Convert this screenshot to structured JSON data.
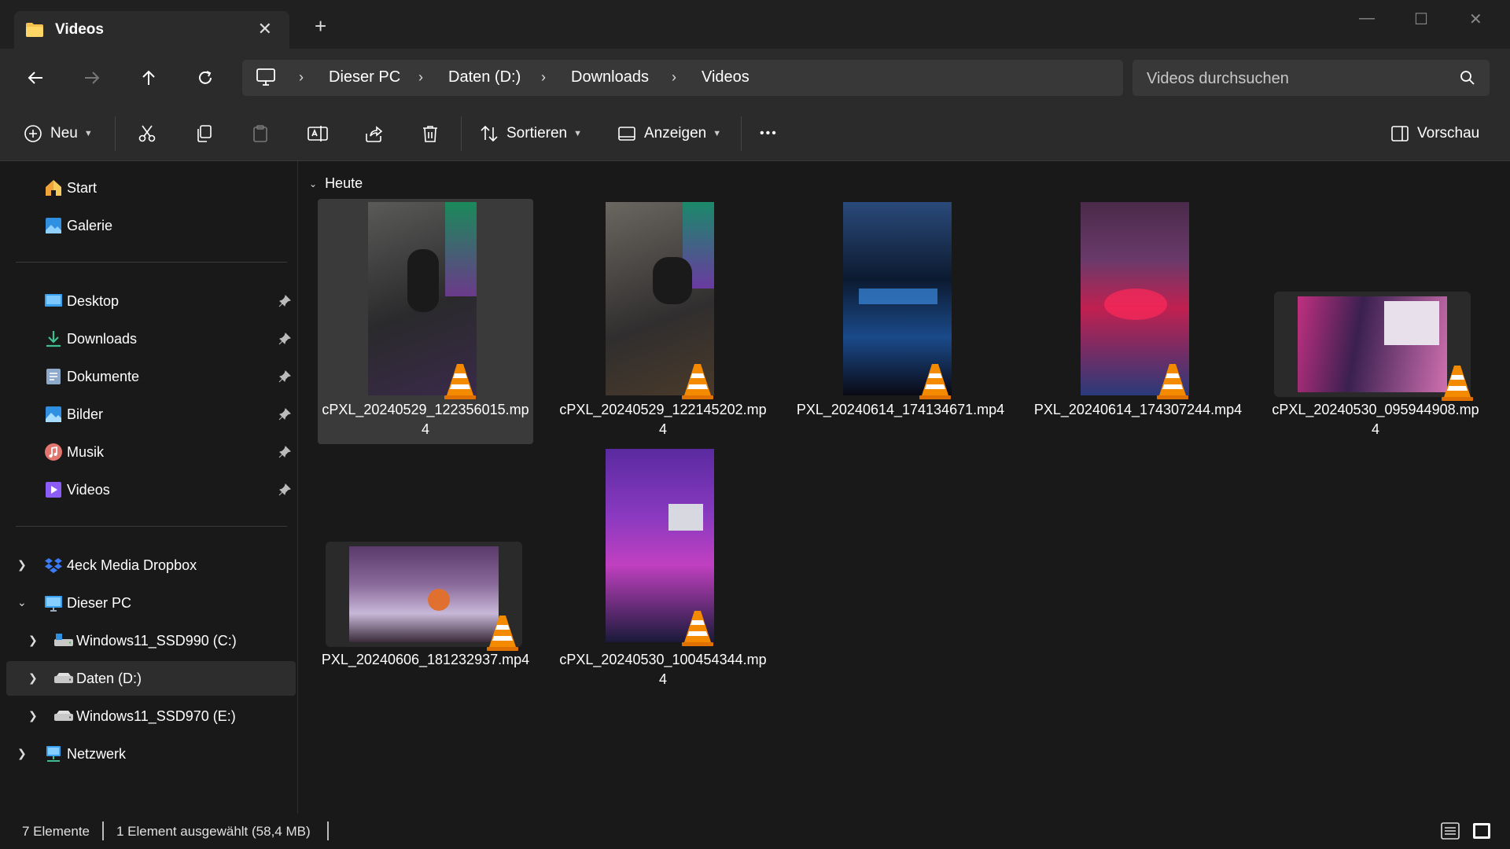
{
  "tab": {
    "title": "Videos",
    "close": "✕",
    "new": "+"
  },
  "window": {
    "minimize": "—",
    "maximize": "☐",
    "close": "✕"
  },
  "address": {
    "crumbs": [
      "Dieser PC",
      "Daten (D:)",
      "Downloads",
      "Videos"
    ],
    "separator": "›"
  },
  "search": {
    "placeholder": "Videos durchsuchen"
  },
  "toolbar": {
    "new_label": "Neu",
    "sort_label": "Sortieren",
    "view_label": "Anzeigen",
    "more_label": "•••",
    "preview_label": "Vorschau"
  },
  "sidebar": {
    "top": [
      {
        "label": "Start",
        "icon": "home-icon"
      },
      {
        "label": "Galerie",
        "icon": "gallery-icon"
      }
    ],
    "quick": [
      {
        "label": "Desktop",
        "icon": "desktop-icon",
        "color": "#3aa0f0"
      },
      {
        "label": "Downloads",
        "icon": "downloads-icon",
        "color": "#3fbf8f"
      },
      {
        "label": "Dokumente",
        "icon": "documents-icon",
        "color": "#8ea9c9"
      },
      {
        "label": "Bilder",
        "icon": "pictures-icon",
        "color": "#2f8fe0"
      },
      {
        "label": "Musik",
        "icon": "music-icon",
        "color": "#e2766e"
      },
      {
        "label": "Videos",
        "icon": "videos-icon",
        "color": "#8b5cf6"
      }
    ],
    "tree": [
      {
        "label": "4eck Media Dropbox",
        "icon": "dropbox-icon",
        "expanded": false
      },
      {
        "label": "Dieser PC",
        "icon": "this-pc-icon",
        "expanded": true
      },
      {
        "label": "Windows11_SSD990 (C:)",
        "icon": "drive-c-icon",
        "expanded": false
      },
      {
        "label": "Daten (D:)",
        "icon": "drive-d-icon",
        "expanded": false,
        "selected": true
      },
      {
        "label": "Windows11_SSD970 (E:)",
        "icon": "drive-e-icon",
        "expanded": false
      },
      {
        "label": "Netzwerk",
        "icon": "network-icon",
        "expanded": false
      }
    ]
  },
  "content": {
    "group_label": "Heute",
    "files": [
      {
        "name": "cPXL_20240529_122356015.mp4",
        "orientation": "portrait",
        "selected": true,
        "colors": [
          "#4a4a48",
          "#2a2a2c",
          "#6b3a8a"
        ]
      },
      {
        "name": "cPXL_20240529_122145202.mp4",
        "orientation": "portrait",
        "selected": false,
        "colors": [
          "#5a5650",
          "#302e2e",
          "#8a6a40"
        ]
      },
      {
        "name": "PXL_20240614_174134671.mp4",
        "orientation": "portrait",
        "selected": false,
        "colors": [
          "#1a3a6a",
          "#0c1a30",
          "#2a6ab0"
        ]
      },
      {
        "name": "PXL_20240614_174307244.mp4",
        "orientation": "portrait",
        "selected": false,
        "colors": [
          "#3a1a3a",
          "#c02050",
          "#6a3a7a"
        ]
      },
      {
        "name": "cPXL_20240530_095944908.mp4",
        "orientation": "landscape",
        "selected": false,
        "colors": [
          "#c03080",
          "#3a2050",
          "#d070b0"
        ]
      },
      {
        "name": "PXL_20240606_181232937.mp4",
        "orientation": "landscape",
        "selected": false,
        "colors": [
          "#5a3a6a",
          "#c8b8d8",
          "#e07030"
        ]
      },
      {
        "name": "cPXL_20240530_100454344.mp4",
        "orientation": "portrait",
        "selected": false,
        "colors": [
          "#5a2aa0",
          "#c040c0",
          "#1a1a3a"
        ]
      }
    ]
  },
  "status": {
    "count": "7 Elemente",
    "selection": "1 Element ausgewählt (58,4 MB)"
  }
}
